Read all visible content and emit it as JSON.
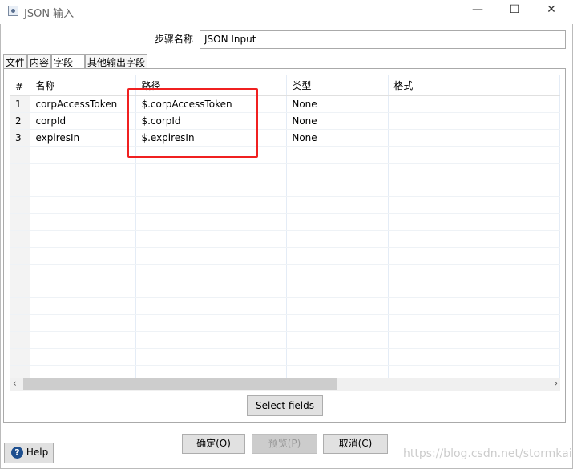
{
  "window": {
    "title": "JSON 输入",
    "minimize": "—",
    "maximize": "☐",
    "close": "✕"
  },
  "step_name": {
    "label": "步骤名称",
    "value": "JSON Input"
  },
  "tabs": [
    {
      "label": "文件"
    },
    {
      "label": "内容"
    },
    {
      "label": "字段",
      "active": true
    },
    {
      "label": "其他输出字段"
    }
  ],
  "table": {
    "headers": [
      "#",
      "名称",
      "路径",
      "类型",
      "格式"
    ],
    "rows": [
      [
        "1",
        "corpAccessToken",
        "$.corpAccessToken",
        "None",
        ""
      ],
      [
        "2",
        "corpId",
        "$.corpId",
        "None",
        ""
      ],
      [
        "3",
        "expiresIn",
        "$.expiresIn",
        "None",
        ""
      ]
    ]
  },
  "select_fields_label": "Select fields",
  "buttons": {
    "ok": "确定(O)",
    "preview": "预览(P)",
    "cancel": "取消(C)",
    "help": "Help"
  },
  "watermark": "https://blog.csdn.net/stormkai",
  "highlight_color": "#f02020"
}
